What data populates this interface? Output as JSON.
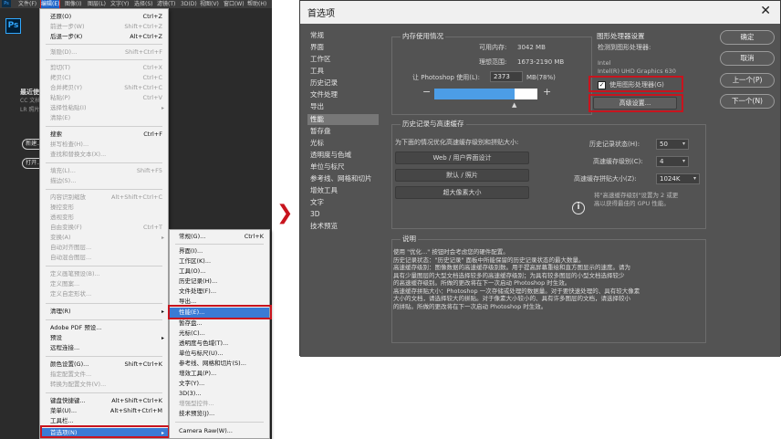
{
  "photoshop": {
    "menubar": [
      "文件(F)",
      "编辑(E)",
      "图像(I)",
      "图层(L)",
      "文字(Y)",
      "选择(S)",
      "滤镜(T)",
      "3D(D)",
      "视图(V)",
      "窗口(W)",
      "帮助(H)"
    ],
    "logo_text": "Ps",
    "side_text": [
      "最近使用项",
      "CC 文档",
      "LR 照片"
    ],
    "buttons": [
      "新建...",
      "打开..."
    ]
  },
  "edit_menu": {
    "items": [
      {
        "label": "还原(O)",
        "shortcut": "Ctrl+Z"
      },
      {
        "label": "前进一步(W)",
        "shortcut": "Shift+Ctrl+Z"
      },
      {
        "label": "后退一步(K)",
        "shortcut": "Alt+Ctrl+Z"
      },
      {
        "label": "渐隐(D)...",
        "shortcut": "Shift+Ctrl+F"
      },
      {
        "label": "剪切(T)",
        "shortcut": "Ctrl+X"
      },
      {
        "label": "拷贝(C)",
        "shortcut": "Ctrl+C"
      },
      {
        "label": "合并拷贝(Y)",
        "shortcut": "Shift+Ctrl+C"
      },
      {
        "label": "粘贴(P)",
        "shortcut": "Ctrl+V"
      },
      {
        "label": "选择性粘贴(I)",
        "shortcut": ""
      },
      {
        "label": "清除(E)",
        "shortcut": ""
      },
      {
        "label": "搜索",
        "shortcut": "Ctrl+F"
      },
      {
        "label": "拼写检查(H)...",
        "shortcut": ""
      },
      {
        "label": "查找和替换文本(X)...",
        "shortcut": ""
      },
      {
        "label": "填充(L)...",
        "shortcut": "Shift+F5"
      },
      {
        "label": "描边(S)...",
        "shortcut": ""
      },
      {
        "label": "内容识别缩放",
        "shortcut": "Alt+Shift+Ctrl+C"
      },
      {
        "label": "操控变形",
        "shortcut": ""
      },
      {
        "label": "透视变形",
        "shortcut": ""
      },
      {
        "label": "自由变换(F)",
        "shortcut": "Ctrl+T"
      },
      {
        "label": "变换(A)",
        "shortcut": ""
      },
      {
        "label": "自动对齐图层...",
        "shortcut": ""
      },
      {
        "label": "自动混合图层...",
        "shortcut": ""
      },
      {
        "label": "定义画笔预设(B)...",
        "shortcut": ""
      },
      {
        "label": "定义图案...",
        "shortcut": ""
      },
      {
        "label": "定义自定形状...",
        "shortcut": ""
      },
      {
        "label": "清理(R)",
        "shortcut": ""
      },
      {
        "label": "Adobe PDF 预设...",
        "shortcut": ""
      },
      {
        "label": "预设",
        "shortcut": ""
      },
      {
        "label": "远程连接...",
        "shortcut": ""
      },
      {
        "label": "颜色设置(G)...",
        "shortcut": "Shift+Ctrl+K"
      },
      {
        "label": "指定配置文件...",
        "shortcut": ""
      },
      {
        "label": "转换为配置文件(V)...",
        "shortcut": ""
      },
      {
        "label": "键盘快捷键...",
        "shortcut": "Alt+Shift+Ctrl+K"
      },
      {
        "label": "菜单(U)...",
        "shortcut": "Alt+Shift+Ctrl+M"
      },
      {
        "label": "工具栏...",
        "shortcut": ""
      },
      {
        "label": "首选项(N)",
        "shortcut": ""
      }
    ]
  },
  "prefs_menu": {
    "items": [
      {
        "label": "常规(G)...",
        "shortcut": "Ctrl+K"
      },
      {
        "label": "界面(I)...",
        "shortcut": ""
      },
      {
        "label": "工作区(K)...",
        "shortcut": ""
      },
      {
        "label": "工具(O)...",
        "shortcut": ""
      },
      {
        "label": "历史记录(H)...",
        "shortcut": ""
      },
      {
        "label": "文件处理(F)...",
        "shortcut": ""
      },
      {
        "label": "导出...",
        "shortcut": ""
      },
      {
        "label": "性能(E)...",
        "shortcut": ""
      },
      {
        "label": "暂存盘...",
        "shortcut": ""
      },
      {
        "label": "光标(C)...",
        "shortcut": ""
      },
      {
        "label": "透明度与色域(T)...",
        "shortcut": ""
      },
      {
        "label": "单位与标尺(U)...",
        "shortcut": ""
      },
      {
        "label": "参考线、网格和切片(S)...",
        "shortcut": ""
      },
      {
        "label": "增效工具(P)...",
        "shortcut": ""
      },
      {
        "label": "文字(Y)...",
        "shortcut": ""
      },
      {
        "label": "3D(3)...",
        "shortcut": ""
      },
      {
        "label": "增强型控件...",
        "shortcut": ""
      },
      {
        "label": "技术预览(J)...",
        "shortcut": ""
      },
      {
        "label": "Camera Raw(W)...",
        "shortcut": ""
      }
    ]
  },
  "arrow_glyph": "❯",
  "dialog": {
    "title": "首选项",
    "close": "✕",
    "nav": [
      "常规",
      "界面",
      "工作区",
      "工具",
      "历史记录",
      "文件处理",
      "导出",
      "性能",
      "暂存盘",
      "光标",
      "透明度与色域",
      "单位与标尺",
      "参考线、网格和切片",
      "增效工具",
      "文字",
      "3D",
      "技术预览"
    ],
    "nav_selected": "性能",
    "memory": {
      "legend": "内存使用情况",
      "available_label": "可用内存:",
      "available_value": "3042 MB",
      "ideal_label": "理想范围:",
      "ideal_value": "1673-2190 MB",
      "let_label": "让 Photoshop 使用(L):",
      "let_value": "2373",
      "percent": "MB(78%)",
      "minus": "−",
      "plus": "+",
      "fraction": 0.78
    },
    "gpu": {
      "legend": "图形处理器设置",
      "detected_label": "检测到图形处理器:",
      "vendor": "Intel",
      "model": "Intel(R) UHD Graphics 630",
      "use_gpu_label": "使用图形处理器(G)",
      "use_gpu_checked": true,
      "advanced_button": "高级设置..."
    },
    "history_cache": {
      "legend": "历史记录与高速缓存",
      "optimize_label": "为下面的情况优化高速缓存级别和拼贴大小:",
      "preset_buttons": [
        "Web / 用户界面设计",
        "默认 / 照片",
        "超大像素大小"
      ],
      "history_states_label": "历史记录状态(H):",
      "history_states_value": "50",
      "cache_levels_label": "高速缓存级别(C):",
      "cache_levels_value": "4",
      "tile_size_label": "高速缓存拼贴大小(Z):",
      "tile_size_value": "1024K",
      "note_lines": [
        "将\"高速缓存级别\"设置为 2 或更",
        "高以获得最佳的 GPU 性能。"
      ]
    },
    "description": {
      "legend": "说明",
      "lines": [
        "使用 \"优化...\" 按钮时会考虑您的硬件配置。",
        "历史记录状态：\"历史记录\" 面板中所能保留的历史记录状态的最大数量。",
        "高速缓存级别：图像数据的高速缓存级别数。用于提高屏幕重绘和直方图显示的速度。请为",
        "具有少量图层的大型文档选择较多的高速缓存级别；为具有较多图层的小型文档选择较少",
        "的高速缓存级别。所做的更改将在下一次启动 Photoshop 时生效。",
        "高速缓存拼贴大小：Photoshop 一次存储或处理的数据量。对于要快速处理的、具有较大像素",
        "大小的文档，请选择较大的拼贴。对于像素大小较小的、具有许多图层的文档，请选择较小",
        "的拼贴。所做的更改将在下一次启动 Photoshop 时生效。"
      ]
    },
    "side_buttons": [
      "确定",
      "取消",
      "上一个(P)",
      "下一个(N)"
    ]
  },
  "colors": {
    "highlight": "#c8141e",
    "menu_selection": "#3a7bd5",
    "dialog_bg": "#535353"
  }
}
